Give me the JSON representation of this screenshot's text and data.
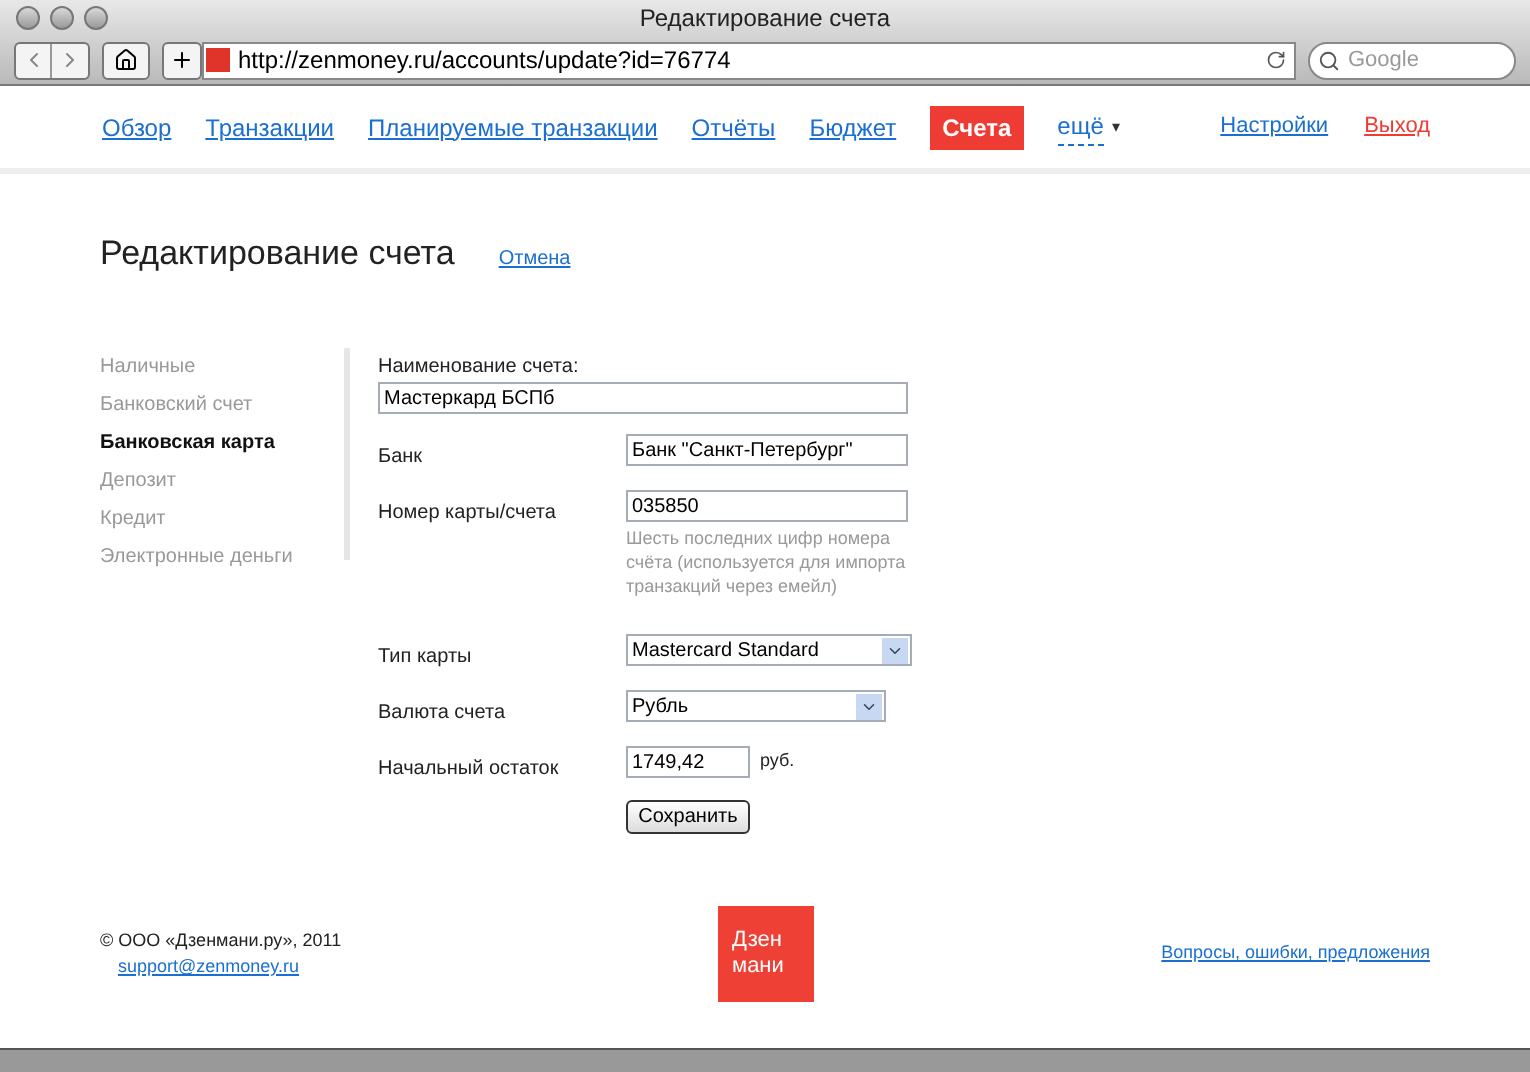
{
  "window": {
    "title": "Редактирование счета"
  },
  "browser": {
    "url": "http://zenmoney.ru/accounts/update?id=76774",
    "search_placeholder": "Google"
  },
  "nav": [
    {
      "label": "Обзор",
      "selected": false
    },
    {
      "label": "Транзакции",
      "selected": false
    },
    {
      "label": "Планируемые транзакции",
      "selected": false
    },
    {
      "label": "Отчёты",
      "selected": false
    },
    {
      "label": "Бюджет",
      "selected": false
    },
    {
      "label": "Счета",
      "selected": true
    }
  ],
  "more": {
    "label": "ещё",
    "caret": "▾"
  },
  "right_links": [
    {
      "label": "Настройки",
      "kind": "normal"
    },
    {
      "label": "Выход",
      "kind": "danger"
    }
  ],
  "page": {
    "title": "Редактирование счета",
    "cancel": "Отмена"
  },
  "account_types": [
    {
      "label": "Наличные",
      "selected": false
    },
    {
      "label": "Банковский счет",
      "selected": false
    },
    {
      "label": "Банковская карта",
      "selected": true
    },
    {
      "label": "Депозит",
      "selected": false
    },
    {
      "label": "Кредит",
      "selected": false
    },
    {
      "label": "Электронные деньги",
      "selected": false
    }
  ],
  "form": {
    "name_label": "Наименование счета:",
    "name_value": "Мастеркард БСПб",
    "rows": [
      {
        "kind": "text",
        "label": "Банк",
        "value": "Банк \"Санкт-Петербург\""
      },
      {
        "kind": "text",
        "label": "Номер карты/счета",
        "value": "035850",
        "hint": "Шесть последних цифр номера счёта (используется для импорта транзакций через емейл)"
      },
      {
        "kind": "select",
        "label": "Тип карты",
        "value": "Mastercard Standard"
      },
      {
        "kind": "select",
        "label": "Валюта счета",
        "value": "Рубль"
      },
      {
        "kind": "amount",
        "label": "Начальный остаток",
        "value": "1749,42",
        "unit": "руб."
      }
    ],
    "save": "Сохранить"
  },
  "footer": {
    "copyright": "© ООО «Дзенмани.ру», 2011",
    "email": "support@zenmoney.ru",
    "logo": [
      "Дзен",
      "мани"
    ],
    "feedback": "Вопросы, ошибки, предложения"
  }
}
